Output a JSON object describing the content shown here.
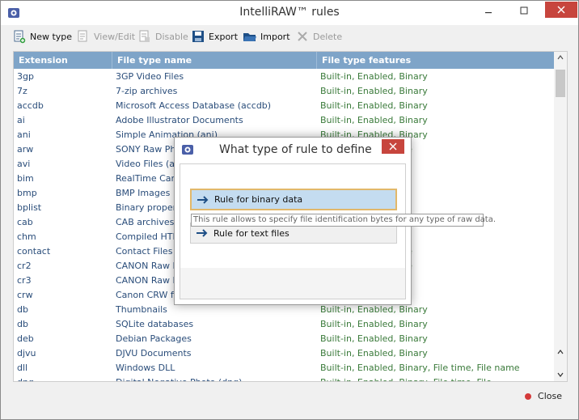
{
  "window": {
    "title": "IntelliRAW™ rules"
  },
  "toolbar": {
    "new_type": "New type",
    "view_edit": "View/Edit",
    "disable": "Disable",
    "export": "Export",
    "import": "Import",
    "delete": "Delete"
  },
  "table": {
    "headers": [
      "Extension",
      "File type name",
      "File type features"
    ],
    "rows": [
      [
        "3gp",
        "3GP Video Files",
        "Built-in, Enabled, Binary"
      ],
      [
        "7z",
        "7-zip archives",
        "Built-in, Enabled, Binary"
      ],
      [
        "accdb",
        "Microsoft Access Database (accdb)",
        "Built-in, Enabled, Binary"
      ],
      [
        "ai",
        "Adobe Illustrator Documents",
        "Built-in, Enabled, Binary"
      ],
      [
        "ani",
        "Simple Animation (ani)",
        "Built-in, Enabled, Binary"
      ],
      [
        "arw",
        "SONY Raw Pho",
        ", File time, File name"
      ],
      [
        "avi",
        "Video Files (avi",
        ""
      ],
      [
        "bim",
        "RealTime Came",
        ""
      ],
      [
        "bmp",
        "BMP Images",
        ""
      ],
      [
        "bplist",
        "Binary properti",
        ""
      ],
      [
        "cab",
        "CAB archives",
        ""
      ],
      [
        "chm",
        "Compiled HTML",
        ""
      ],
      [
        "contact",
        "Contact Files",
        ", File time, File name"
      ],
      [
        "cr2",
        "CANON Raw Ph",
        ", File time, File name"
      ],
      [
        "cr3",
        "CANON Raw Ph",
        ""
      ],
      [
        "crw",
        "Canon CRW file",
        ""
      ],
      [
        "db",
        "Thumbnails",
        "Built-in, Enabled, Binary"
      ],
      [
        "db",
        "SQLite databases",
        "Built-in, Enabled, Binary"
      ],
      [
        "deb",
        "Debian Packages",
        "Built-in, Enabled, Binary"
      ],
      [
        "djvu",
        "DJVU Documents",
        "Built-in, Enabled, Binary"
      ],
      [
        "dll",
        "Windows DLL",
        "Built-in, Enabled, Binary, File time, File name"
      ],
      [
        "dng",
        "Digital Negative Photo (dng)",
        "Built-in, Enabled, Binary, File time, File..."
      ]
    ]
  },
  "footer": {
    "close": "Close"
  },
  "dialog": {
    "title": "What type of rule to define",
    "option_binary": "Rule for binary data",
    "option_text": "Rule for text files",
    "tooltip": "This rule allows to specify file identification bytes for any type of raw data."
  },
  "colors": {
    "header_bg": "#7ea4c8",
    "accent_red": "#c7453d",
    "selection": "#c4dcf0",
    "selection_border": "#e2b86a"
  }
}
